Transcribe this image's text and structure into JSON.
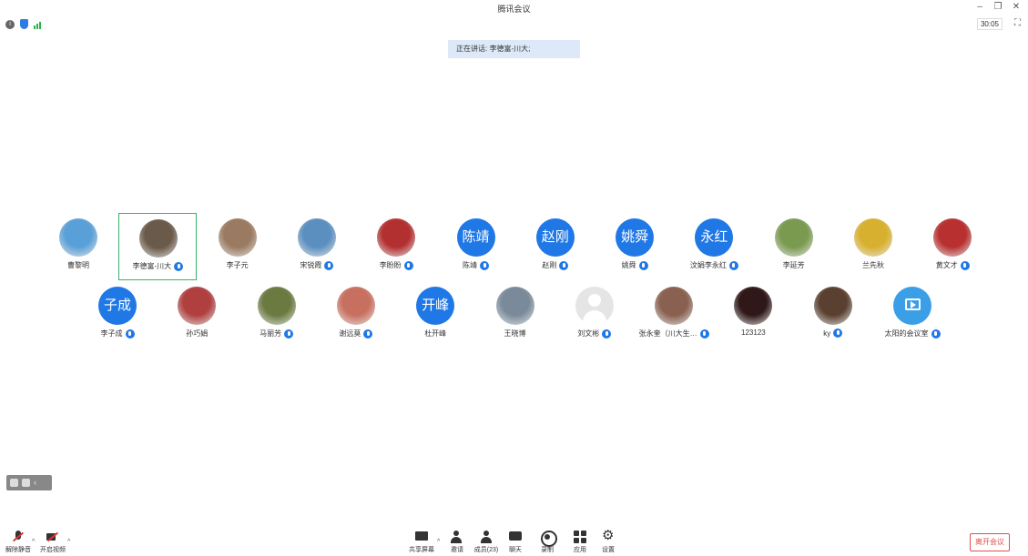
{
  "window": {
    "title": "腾讯会议",
    "timer": "30:05"
  },
  "banner": {
    "speaking": "正在讲话: 李德富-川大;"
  },
  "participants_row1": [
    {
      "name": "曹黎明",
      "avatar": "photo",
      "color": "#5aa0d8",
      "mic": false
    },
    {
      "name": "李德富-川大",
      "avatar": "photo",
      "color": "#6a5a4a",
      "mic": true,
      "active": true
    },
    {
      "name": "李子元",
      "avatar": "photo",
      "color": "#9a7a60",
      "mic": false
    },
    {
      "name": "宋锐霞",
      "avatar": "photo",
      "color": "#5b8fbf",
      "mic": true
    },
    {
      "name": "李盼盼",
      "avatar": "photo",
      "color": "#b23030",
      "mic": true
    },
    {
      "name": "陈靖",
      "avatar": "text",
      "avatar_text": "陈靖",
      "mic": true
    },
    {
      "name": "赵刚",
      "avatar": "text",
      "avatar_text": "赵刚",
      "mic": true
    },
    {
      "name": "姚舜",
      "avatar": "text",
      "avatar_text": "姚舜",
      "mic": true
    },
    {
      "name": "汶娟李永红",
      "avatar": "text",
      "avatar_text": "永红",
      "mic": true
    },
    {
      "name": "李延芳",
      "avatar": "photo",
      "color": "#7a9a50",
      "mic": false
    },
    {
      "name": "兰先秋",
      "avatar": "photo",
      "color": "#d8b030",
      "mic": false
    },
    {
      "name": "黄文才",
      "avatar": "photo",
      "color": "#b83030",
      "mic": true
    }
  ],
  "participants_row2": [
    {
      "name": "李子成",
      "avatar": "text",
      "avatar_text": "子成",
      "mic": true
    },
    {
      "name": "孙巧娟",
      "avatar": "photo",
      "color": "#b04040",
      "mic": false
    },
    {
      "name": "马丽芳",
      "avatar": "photo",
      "color": "#6a7a40",
      "mic": true
    },
    {
      "name": "谢远莫",
      "avatar": "photo",
      "color": "#c87060",
      "mic": true
    },
    {
      "name": "杜开峰",
      "avatar": "text",
      "avatar_text": "开峰",
      "mic": false
    },
    {
      "name": "王晓博",
      "avatar": "photo",
      "color": "#7a8a9a",
      "mic": false
    },
    {
      "name": "刘文彬",
      "avatar": "default",
      "mic": true
    },
    {
      "name": "张永奎（川大生…",
      "avatar": "photo",
      "color": "#8a6050",
      "mic": true
    },
    {
      "name": "123123",
      "avatar": "photo",
      "color": "#301818",
      "mic": false
    },
    {
      "name": "ky",
      "avatar": "photo",
      "color": "#5a4030",
      "mic": true
    },
    {
      "name": "太阳的会议室",
      "avatar": "screen",
      "mic": true
    }
  ],
  "toolbar": {
    "unmute": "解除静音",
    "start_video": "开启视频",
    "share": "共享屏幕",
    "invite": "邀请",
    "members": "成员(23)",
    "chat": "聊天",
    "record": "录制",
    "apps": "应用",
    "settings": "设置",
    "leave": "离开会议"
  }
}
